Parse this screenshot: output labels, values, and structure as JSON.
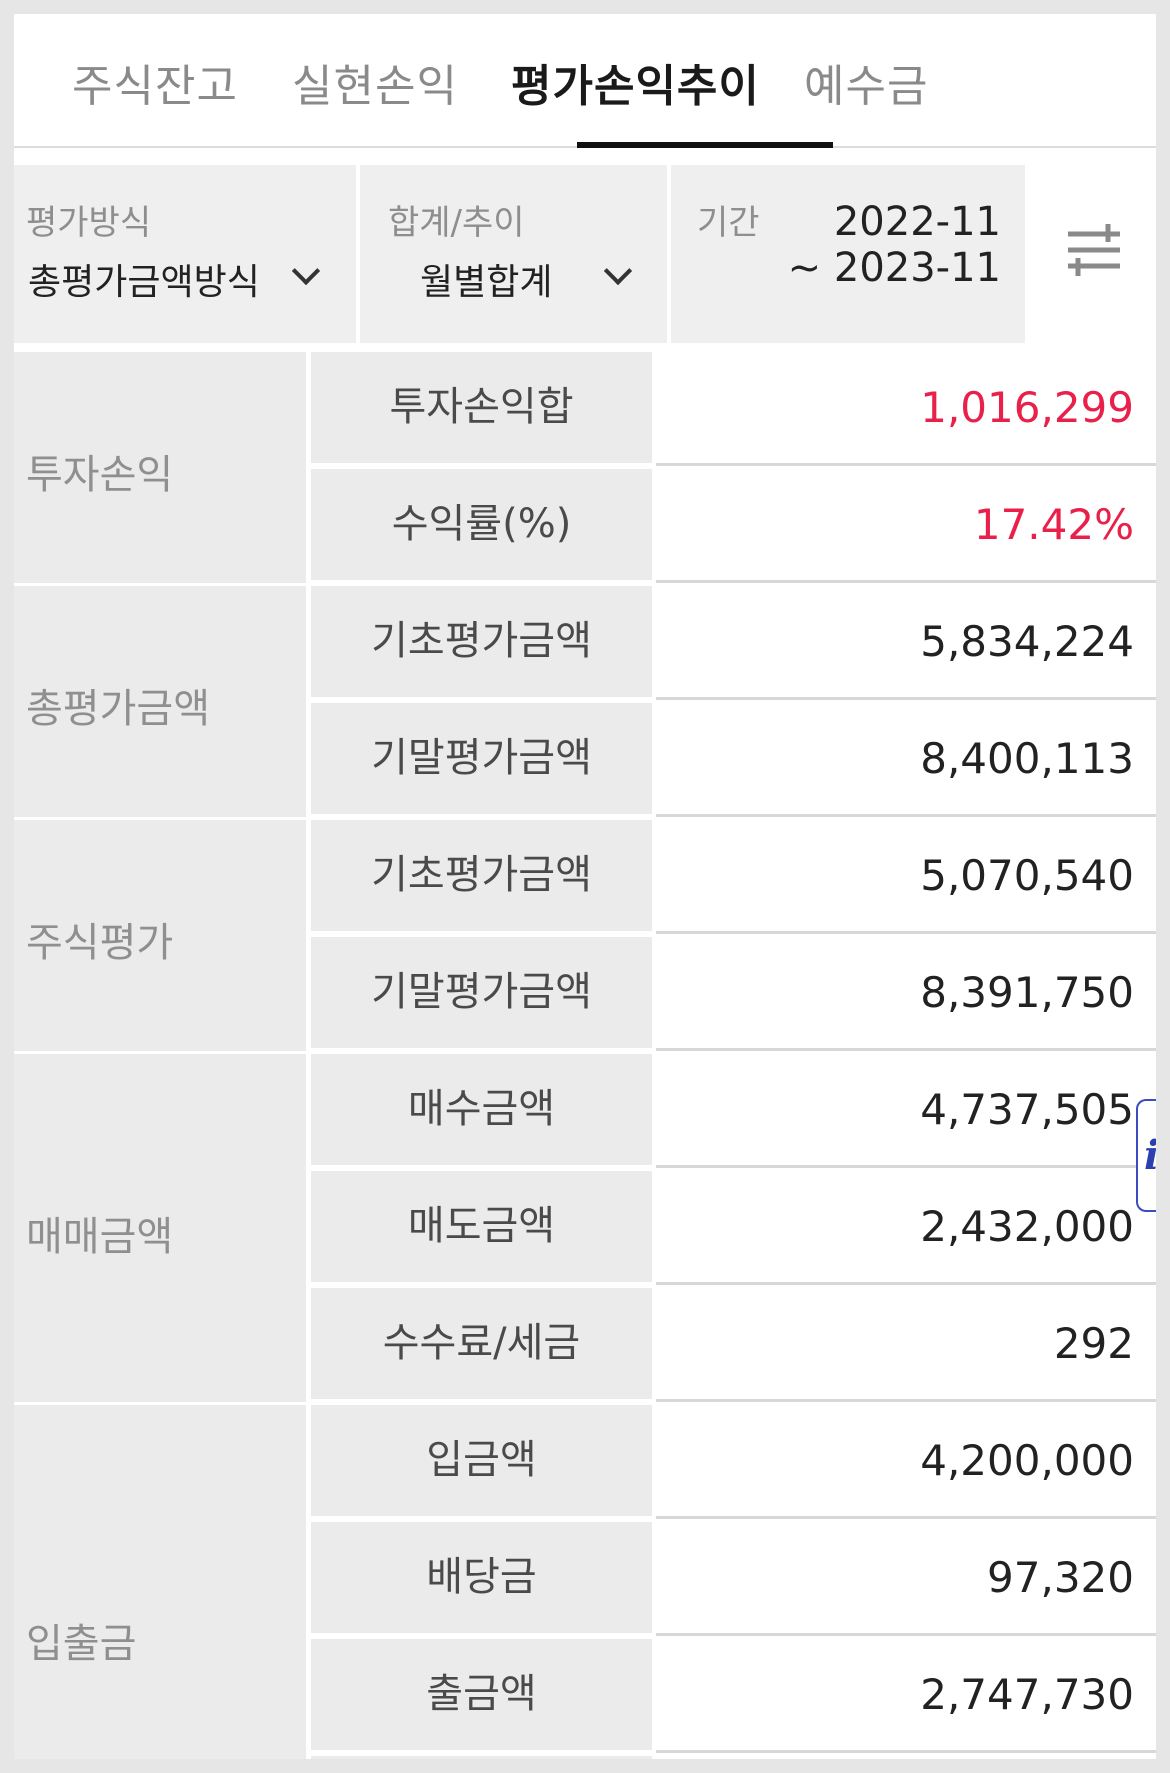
{
  "tabs": [
    {
      "label": "주식잔고",
      "active": false
    },
    {
      "label": "실현손익",
      "active": false
    },
    {
      "label": "평가손익추이",
      "active": true
    },
    {
      "label": "예수금",
      "active": false
    }
  ],
  "filters": {
    "method": {
      "label": "평가방식",
      "value": "총평가금액방식"
    },
    "summary": {
      "label": "합계/추이",
      "value": "월별합계"
    },
    "period": {
      "label": "기간",
      "start": "2022-11",
      "end": "~ 2023-11"
    },
    "settings_icon": "sliders-icon"
  },
  "groups": [
    {
      "label": "투자손익",
      "rows": [
        {
          "label": "투자손익합",
          "value": "1,016,299",
          "positive": true
        },
        {
          "label": "수익률(%)",
          "value": "17.42%",
          "positive": true
        }
      ]
    },
    {
      "label": "총평가금액",
      "rows": [
        {
          "label": "기초평가금액",
          "value": "5,834,224"
        },
        {
          "label": "기말평가금액",
          "value": "8,400,113"
        }
      ]
    },
    {
      "label": "주식평가",
      "rows": [
        {
          "label": "기초평가금액",
          "value": "5,070,540"
        },
        {
          "label": "기말평가금액",
          "value": "8,391,750"
        }
      ]
    },
    {
      "label": "매매금액",
      "rows": [
        {
          "label": "매수금액",
          "value": "4,737,505"
        },
        {
          "label": "매도금액",
          "value": "2,432,000"
        },
        {
          "label": "수수료/세금",
          "value": "292"
        }
      ]
    },
    {
      "label": "입출금",
      "rows": [
        {
          "label": "입금액",
          "value": "4,200,000"
        },
        {
          "label": "배당금",
          "value": "97,320"
        },
        {
          "label": "출금액",
          "value": "2,747,730"
        }
      ]
    }
  ],
  "side_badge": {
    "text": "i",
    "icon": "info-icon"
  },
  "colors": {
    "positive": "#e8204a",
    "accent": "#111111",
    "badge": "#3b4cc0"
  }
}
